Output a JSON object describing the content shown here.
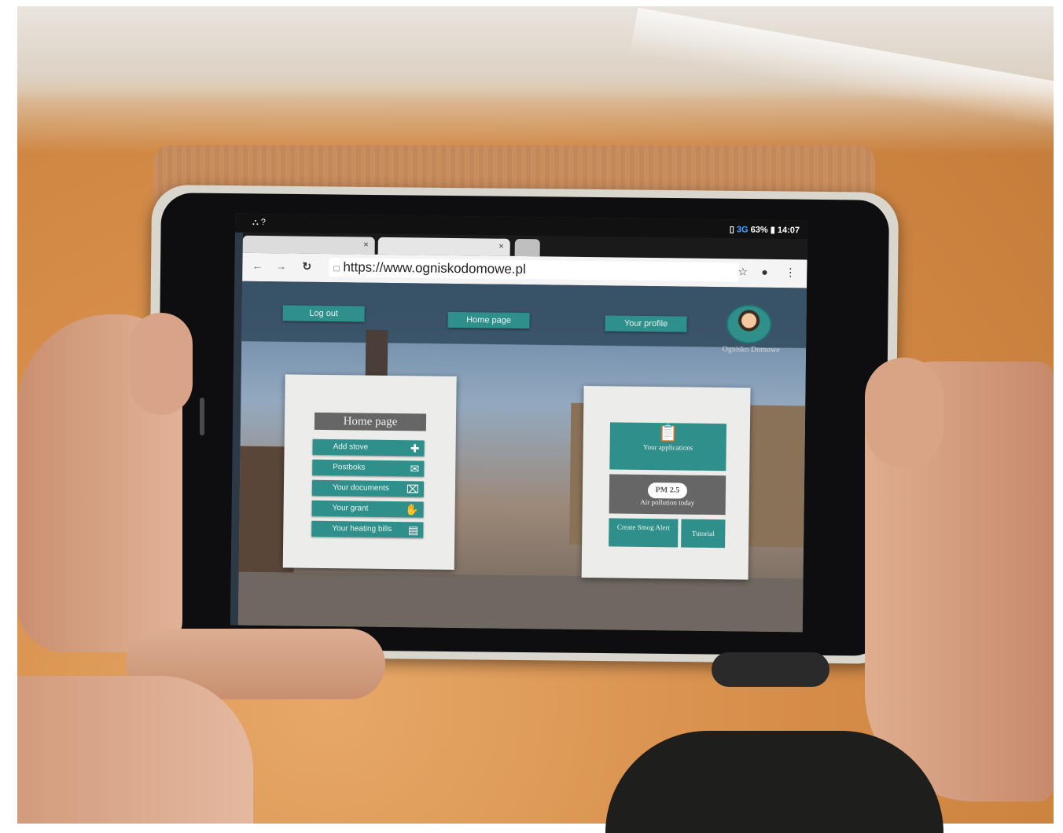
{
  "statusbar": {
    "left_icons": "⛬ ?",
    "network": "3G",
    "battery": "63%",
    "time": "14:07"
  },
  "browser": {
    "tab_close": "×",
    "url": "https://www.ogniskodomowe.pl",
    "back_icon": "arrow-left-icon",
    "forward_icon": "arrow-right-icon",
    "reload_icon": "reload-icon",
    "lock_icon": "page-icon",
    "star_icon": "star-icon",
    "mic_icon": "mic-icon",
    "menu_icon": "more-vert-icon"
  },
  "topnav": {
    "logout": "Log out",
    "home": "Home page",
    "profile": "Your profile",
    "avatar_name": "Ognisko Domowe"
  },
  "left_panel": {
    "title": "Home page",
    "items": [
      {
        "label": "Add stove",
        "icon": "plus-icon"
      },
      {
        "label": "Postboks",
        "icon": "envelope-icon"
      },
      {
        "label": "Your documents",
        "icon": "paperclip-icon"
      },
      {
        "label": "Your grant",
        "icon": "hand-coin-icon"
      },
      {
        "label": "Your heating bills",
        "icon": "bill-icon"
      }
    ]
  },
  "right_panel": {
    "applications": "Your applications",
    "pm_label": "PM 2.5",
    "air_pollution": "Air pollution today",
    "alert": "Create Smog Alert",
    "tutorial": "Tutorial"
  },
  "colors": {
    "accent": "#2f8f8a",
    "header_bar": "#324b5f",
    "panel_bg": "#ececea",
    "grey_tile": "#666666"
  }
}
